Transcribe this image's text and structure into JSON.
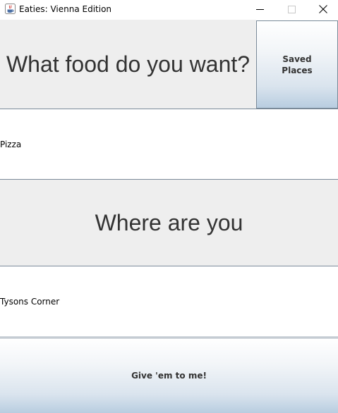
{
  "window": {
    "title": "Eaties: Vienna Edition",
    "app_icon": "java-icon",
    "controls": {
      "minimize_icon": "minimize-icon",
      "maximize_icon": "maximize-icon",
      "close_icon": "close-icon"
    }
  },
  "food_section": {
    "prompt": "What food do you want?",
    "value": "Pizza"
  },
  "saved_places_button": {
    "label": "Saved\nPlaces"
  },
  "location_section": {
    "prompt": "Where are you",
    "value": "Tysons Corner"
  },
  "submit_button": {
    "label": "Give 'em to me!"
  },
  "colors": {
    "panel_background": "#eeeeee",
    "label_text": "#333333",
    "divider": "#7a8a99",
    "button_gradient_bottom": "#b8cde0"
  }
}
